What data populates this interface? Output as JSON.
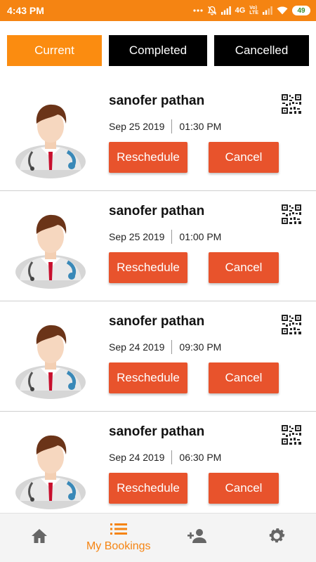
{
  "status_bar": {
    "time": "4:43 PM",
    "network": "4G",
    "volte_top": "Vo)",
    "volte_bottom": "LTE",
    "battery": "49"
  },
  "tabs": [
    {
      "label": "Current",
      "active": true
    },
    {
      "label": "Completed",
      "active": false
    },
    {
      "label": "Cancelled",
      "active": false
    }
  ],
  "bookings": [
    {
      "name": "sanofer pathan",
      "date": "Sep 25 2019",
      "time": "01:30 PM",
      "reschedule_label": "Reschedule",
      "cancel_label": "Cancel"
    },
    {
      "name": "sanofer pathan",
      "date": "Sep 25 2019",
      "time": "01:00 PM",
      "reschedule_label": "Reschedule",
      "cancel_label": "Cancel"
    },
    {
      "name": "sanofer pathan",
      "date": "Sep 24 2019",
      "time": "09:30 PM",
      "reschedule_label": "Reschedule",
      "cancel_label": "Cancel"
    },
    {
      "name": "sanofer pathan",
      "date": "Sep 24 2019",
      "time": "06:30 PM",
      "reschedule_label": "Reschedule",
      "cancel_label": "Cancel"
    }
  ],
  "bottom_nav": {
    "items": [
      {
        "icon": "home-icon",
        "label": ""
      },
      {
        "icon": "list-icon",
        "label": "My Bookings",
        "active": true
      },
      {
        "icon": "add-user-icon",
        "label": ""
      },
      {
        "icon": "gear-icon",
        "label": ""
      }
    ]
  },
  "colors": {
    "accent": "#f58412",
    "button": "#e8532c",
    "inactive_tab": "#000000"
  }
}
